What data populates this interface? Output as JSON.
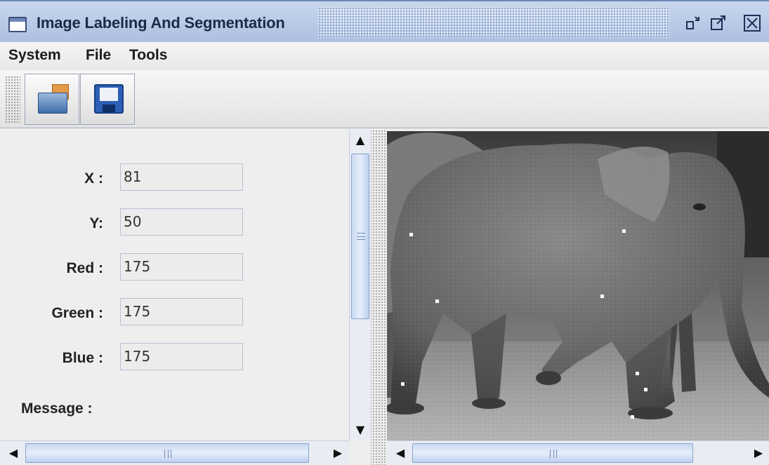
{
  "window": {
    "title": "Image Labeling And Segmentation"
  },
  "menu": [
    "System",
    "File",
    "Tools"
  ],
  "toolbar": {
    "open_icon": "open-folder-icon",
    "save_icon": "floppy-disk-icon"
  },
  "fields": [
    {
      "label": "X :",
      "value": "81"
    },
    {
      "label": "Y:",
      "value": "50"
    },
    {
      "label": "Red :",
      "value": "175"
    },
    {
      "label": "Green :",
      "value": "175"
    },
    {
      "label": "Blue :",
      "value": "175"
    }
  ],
  "message_label": "Message :",
  "image": {
    "subject": "grayscale elephant photograph with white labeling markers"
  },
  "scrollbar": {
    "grip_glyph": "III"
  }
}
